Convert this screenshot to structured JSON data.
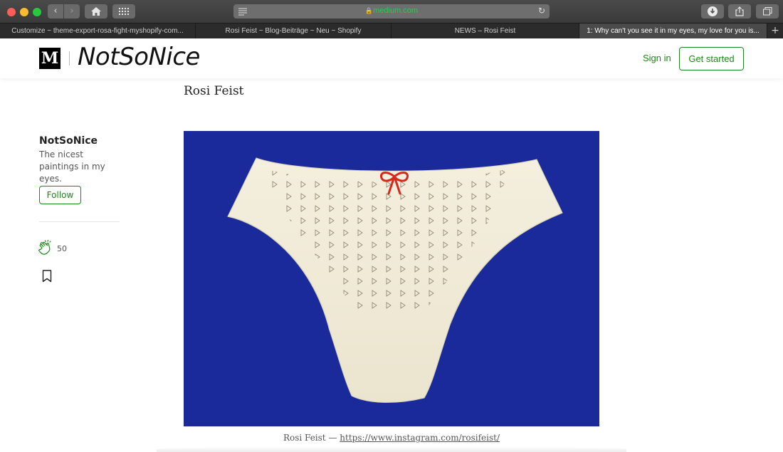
{
  "browser": {
    "url": "medium.com",
    "tabs": [
      {
        "label": "Customize ~ theme-export-rosa-fight-myshopify-com..."
      },
      {
        "label": "Rosi Feist ~ Blog-Beiträge ~ Neu ~ Shopify"
      },
      {
        "label": "NEWS – Rosi Feist"
      },
      {
        "label": "1: Why can't you see it in my eyes, my love for you is..."
      }
    ],
    "new_tab": "+"
  },
  "header": {
    "logo_letter": "M",
    "publication": "NotSoNice",
    "sign_in": "Sign in",
    "get_started": "Get started"
  },
  "article": {
    "author": "Rosi Feist",
    "caption_prefix": "Rosi Feist — ",
    "caption_link": "https://www.instagram.com/rosifeist/",
    "image_subject": "paper-cut white underwear with red bow on blue background"
  },
  "sidebar": {
    "title": "NotSoNice",
    "description": "The nicest paintings in my eyes.",
    "follow": "Follow",
    "claps": "50"
  },
  "colors": {
    "accent_green": "#1a8917",
    "artwork_blue": "#1a2a9a",
    "paper_cream": "#f2eddc",
    "bow_red": "#d8281c"
  }
}
